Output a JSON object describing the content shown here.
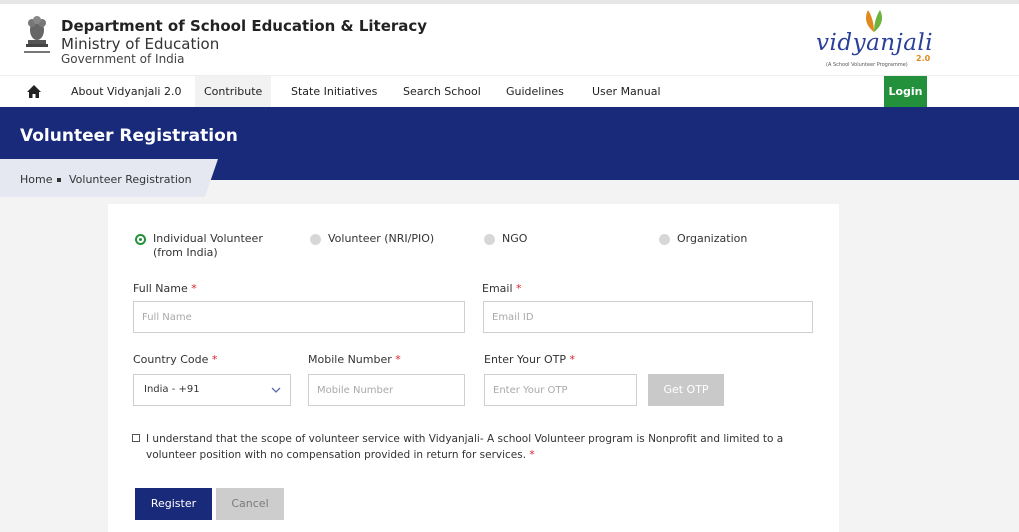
{
  "header": {
    "department": "Department of School Education & Literacy",
    "ministry": "Ministry of Education",
    "government": "Government of India",
    "logo": {
      "name": "vidyanjali",
      "version": "2.0",
      "tagline": "(A School Volunteer Programme)"
    }
  },
  "nav": {
    "items": [
      {
        "label": "About Vidyanjali 2.0"
      },
      {
        "label": "Contribute"
      },
      {
        "label": "State Initiatives"
      },
      {
        "label": "Search School"
      },
      {
        "label": "Guidelines"
      },
      {
        "label": "User Manual"
      }
    ],
    "active": "Contribute",
    "login_label": "Login"
  },
  "banner": {
    "title": "Volunteer Registration",
    "breadcrumb": {
      "home": "Home",
      "current": "Volunteer Registration"
    }
  },
  "form": {
    "volunteer_types": [
      {
        "label_line1": "Individual Volunteer",
        "label_line2": "(from India)",
        "selected": true
      },
      {
        "label_line1": "Volunteer (NRI/PIO)",
        "label_line2": "",
        "selected": false
      },
      {
        "label_line1": "NGO",
        "label_line2": "",
        "selected": false
      },
      {
        "label_line1": "Organization",
        "label_line2": "",
        "selected": false
      }
    ],
    "full_name": {
      "label": "Full Name",
      "placeholder": "Full Name",
      "value": ""
    },
    "email": {
      "label": "Email",
      "placeholder": "Email ID",
      "value": ""
    },
    "country_code": {
      "label": "Country Code",
      "value": "India - +91"
    },
    "mobile": {
      "label": "Mobile Number",
      "placeholder": "Mobile Number",
      "value": ""
    },
    "otp": {
      "label": "Enter Your OTP",
      "placeholder": "Enter Your OTP",
      "value": ""
    },
    "get_otp_label": "Get OTP",
    "required_marker": "*",
    "consent_text": "I understand that the scope of volunteer service with Vidyanjali- A school Volunteer program is Nonprofit and limited to a volunteer position with no compensation provided in return for services.",
    "consent_checked": false,
    "register_label": "Register",
    "cancel_label": "Cancel"
  },
  "colors": {
    "brand_navy": "#1a2a7a",
    "accent_green": "#23913b",
    "required_red": "#d9232d"
  },
  "icons": {
    "home": "home-icon",
    "emblem": "emblem-icon",
    "dropdown": "chevron-down-icon"
  }
}
